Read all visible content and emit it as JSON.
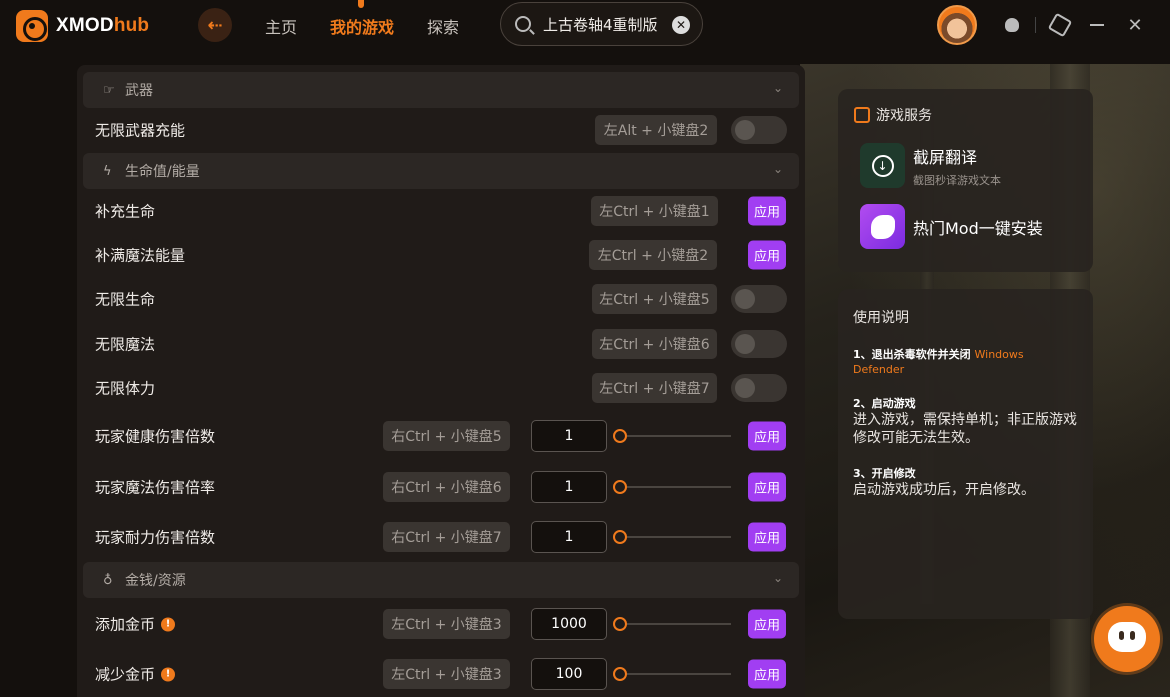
{
  "app": {
    "logo_main": "XMOD",
    "logo_accent": "hub"
  },
  "nav": {
    "home": "主页",
    "my_games": "我的游戏",
    "explore": "探索"
  },
  "search": {
    "value": "上古卷轴4重制版"
  },
  "sections": [
    {
      "title": "武器"
    },
    {
      "title": "生命值/能量"
    },
    {
      "title": "金钱/资源"
    }
  ],
  "rows": {
    "weapon_charge": {
      "label": "无限武器充能",
      "hotkey": "左Alt + 小键盘2"
    },
    "restore_health": {
      "label": "补充生命",
      "hotkey": "左Ctrl + 小键盘1",
      "apply": "应用"
    },
    "fill_magicka": {
      "label": "补满魔法能量",
      "hotkey": "左Ctrl + 小键盘2",
      "apply": "应用"
    },
    "inf_health": {
      "label": "无限生命",
      "hotkey": "左Ctrl + 小键盘5"
    },
    "inf_magicka": {
      "label": "无限魔法",
      "hotkey": "左Ctrl + 小键盘6"
    },
    "inf_stamina": {
      "label": "无限体力",
      "hotkey": "左Ctrl + 小键盘7"
    },
    "health_dmg": {
      "label": "玩家健康伤害倍数",
      "hotkey": "右Ctrl + 小键盘5",
      "value": "1",
      "apply": "应用"
    },
    "magic_dmg": {
      "label": "玩家魔法伤害倍率",
      "hotkey": "右Ctrl + 小键盘6",
      "value": "1",
      "apply": "应用"
    },
    "stamina_dmg": {
      "label": "玩家耐力伤害倍数",
      "hotkey": "右Ctrl + 小键盘7",
      "value": "1",
      "apply": "应用"
    },
    "add_gold": {
      "label": "添加金币",
      "hotkey": "左Ctrl + 小键盘3",
      "value": "1000",
      "apply": "应用"
    },
    "sub_gold": {
      "label": "减少金币",
      "hotkey": "左Ctrl + 小键盘3",
      "value": "100",
      "apply": "应用"
    }
  },
  "services": {
    "title": "游戏服务",
    "items": [
      {
        "name": "截屏翻译",
        "sub": "截图秒译游戏文本"
      },
      {
        "name": "热门Mod一键安装",
        "sub": ""
      }
    ]
  },
  "help": {
    "title": "使用说明",
    "steps": [
      {
        "num": "1、退出杀毒软件并关闭",
        "highlight": "Windows Defender",
        "body": ""
      },
      {
        "num": "2、启动游戏",
        "highlight": "",
        "body": "进入游戏，需保持单机；非正版游戏修改可能无法生效。"
      },
      {
        "num": "3、开启修改",
        "highlight": "",
        "body": "启动游戏成功后，开启修改。"
      }
    ]
  },
  "colors": {
    "accent": "#f07a1c",
    "apply": "#a13ef2",
    "panel": "#201b18"
  }
}
